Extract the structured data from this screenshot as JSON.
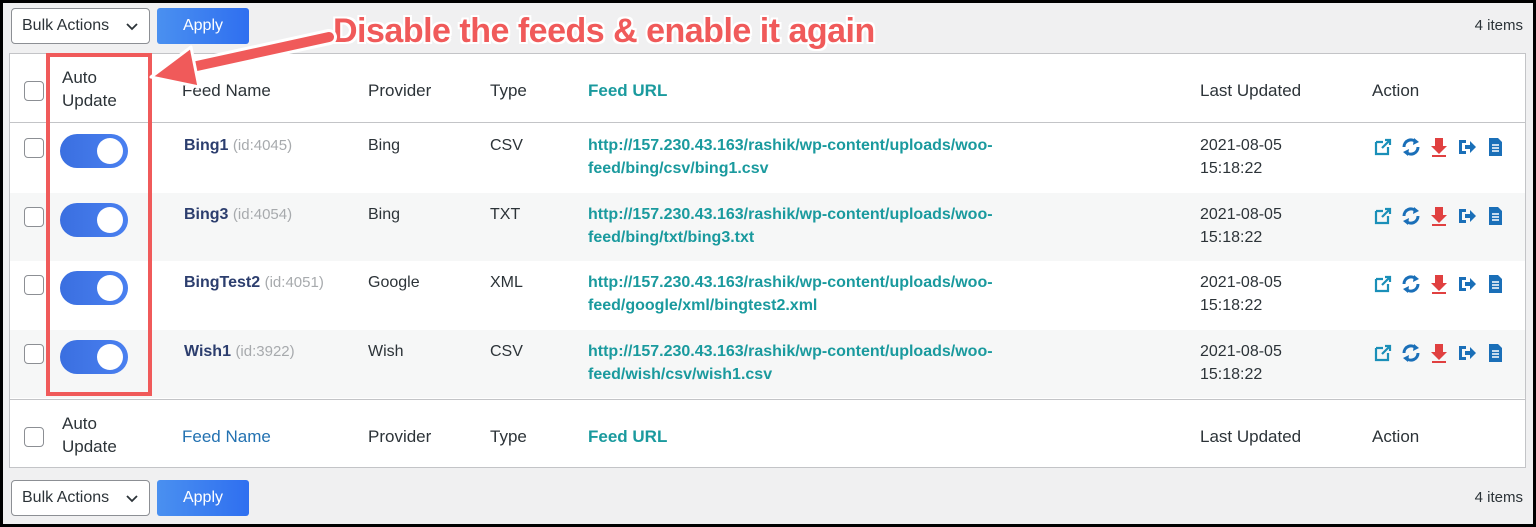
{
  "annotation": "Disable the feeds & enable it again",
  "bulk_actions": {
    "label": "Bulk Actions",
    "apply_label": "Apply"
  },
  "items_count": "4 items",
  "columns": {
    "auto_update_line1": "Auto",
    "auto_update_line2": "Update",
    "feed_name": "Feed Name",
    "provider": "Provider",
    "type": "Type",
    "feed_url": "Feed URL",
    "last_updated": "Last Updated",
    "action": "Action"
  },
  "rows": [
    {
      "name": "Bing1",
      "id": "(id:4045)",
      "provider": "Bing",
      "type": "CSV",
      "url_line1": "http://157.230.43.163/rashik/wp-content/uploads/woo-",
      "url_line2": "feed/bing/csv/bing1.csv",
      "date": "2021-08-05",
      "time": "15:18:22",
      "auto_update": true
    },
    {
      "name": "Bing3",
      "id": "(id:4054)",
      "provider": "Bing",
      "type": "TXT",
      "url_line1": "http://157.230.43.163/rashik/wp-content/uploads/woo-",
      "url_line2": "feed/bing/txt/bing3.txt",
      "date": "2021-08-05",
      "time": "15:18:22",
      "auto_update": true
    },
    {
      "name": "BingTest2",
      "id": "(id:4051)",
      "provider": "Google",
      "type": "XML",
      "url_line1": "http://157.230.43.163/rashik/wp-content/uploads/woo-",
      "url_line2": "feed/google/xml/bingtest2.xml",
      "date": "2021-08-05",
      "time": "15:18:22",
      "auto_update": true
    },
    {
      "name": "Wish1",
      "id": "(id:3922)",
      "provider": "Wish",
      "type": "CSV",
      "url_line1": "http://157.230.43.163/rashik/wp-content/uploads/woo-",
      "url_line2": "feed/wish/csv/wish1.csv",
      "date": "2021-08-05",
      "time": "15:18:22",
      "auto_update": true
    }
  ],
  "colors": {
    "accent": "#2271b1",
    "teal": "#1a9a9e",
    "annotation": "#f05a5a",
    "toggle": "#3a6fe0"
  },
  "action_icons": [
    "external-link-icon",
    "refresh-icon",
    "download-icon",
    "export-icon",
    "document-icon"
  ]
}
